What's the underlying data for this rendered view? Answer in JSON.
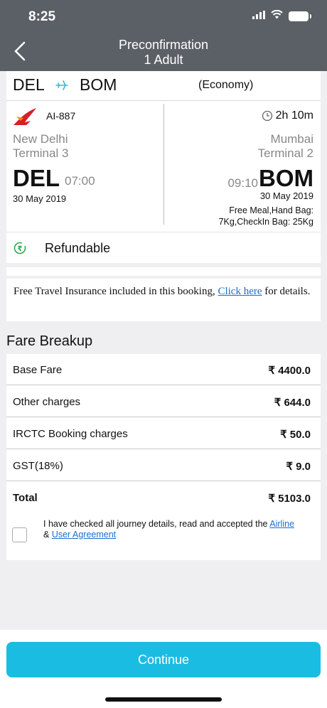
{
  "status": {
    "time": "8:25"
  },
  "header": {
    "title": "Preconfirmation",
    "subtitle": "1 Adult"
  },
  "route": {
    "from": "DEL",
    "to": "BOM",
    "cabin": "(Economy)"
  },
  "flight": {
    "number": "AI-887",
    "duration": "2h 10m",
    "dep_city": "New Delhi",
    "dep_terminal": "Terminal  3",
    "dep_code": "DEL",
    "dep_time": "07:00",
    "dep_date": "30 May 2019",
    "arr_city": "Mumbai",
    "arr_terminal": "Terminal  2",
    "arr_code": "BOM",
    "arr_time": "09:10",
    "arr_date": "30 May 2019",
    "baggage_line1": "Free Meal,Hand Bag:",
    "baggage_line2": "7Kg,CheckIn Bag: 25Kg"
  },
  "refund": {
    "label": "Refundable"
  },
  "insurance": {
    "text_before": "Free Travel Insurance included in this booking, ",
    "link": "Click here",
    "text_after": " for details."
  },
  "fare": {
    "title": "Fare Breakup",
    "rows": [
      {
        "label": "Base Fare",
        "value": "₹ 4400.0"
      },
      {
        "label": "Other charges",
        "value": "₹ 644.0"
      },
      {
        "label": "IRCTC Booking charges",
        "value": "₹ 50.0"
      },
      {
        "label": "GST(18%)",
        "value": "₹ 9.0"
      }
    ],
    "total": {
      "label": "Total",
      "value": "₹ 5103.0"
    }
  },
  "agreement": {
    "text": "I have checked all journey details, read and accepted the ",
    "link1": "Airline",
    "amp": " & ",
    "link2": "User Agreement"
  },
  "footer": {
    "continue_label": "Continue"
  },
  "colors": {
    "header": "#5b6066",
    "accent": "#1bbce2",
    "refund_green": "#2aa84a",
    "link": "#1a6ecf",
    "airline_red": "#d4202a"
  }
}
